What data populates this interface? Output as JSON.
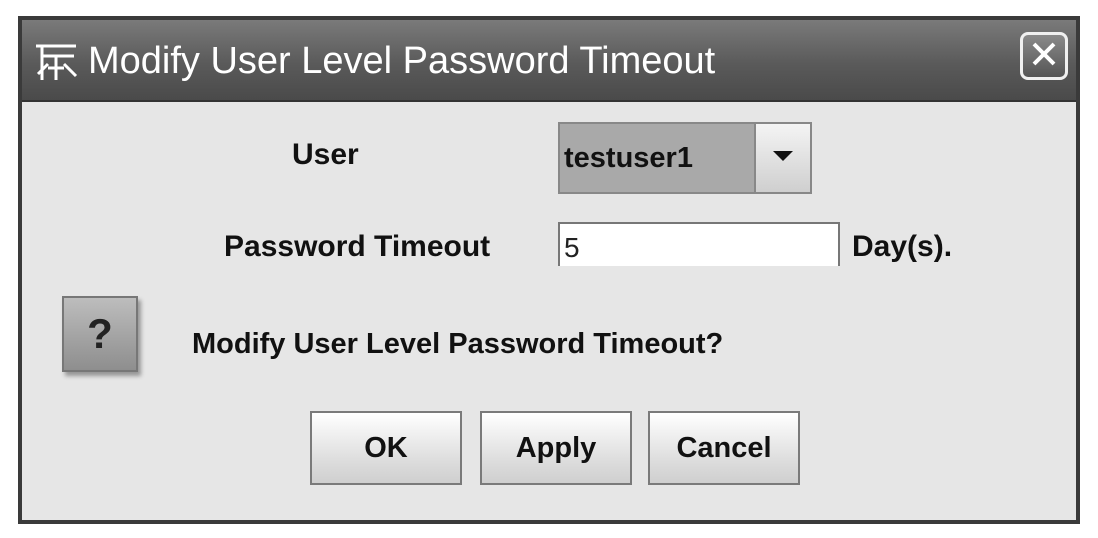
{
  "window": {
    "title": "Modify User Level Password Timeout",
    "icon": "app-logo-icon",
    "close_icon": "close-icon"
  },
  "form": {
    "user_label": "User",
    "user_selected": "testuser1",
    "timeout_label": "Password Timeout",
    "timeout_value": "5",
    "timeout_unit": "Day(s)."
  },
  "prompt": {
    "icon": "question-icon",
    "icon_glyph": "?",
    "message": "Modify User Level Password Timeout?"
  },
  "buttons": {
    "ok": "OK",
    "apply": "Apply",
    "cancel": "Cancel"
  }
}
